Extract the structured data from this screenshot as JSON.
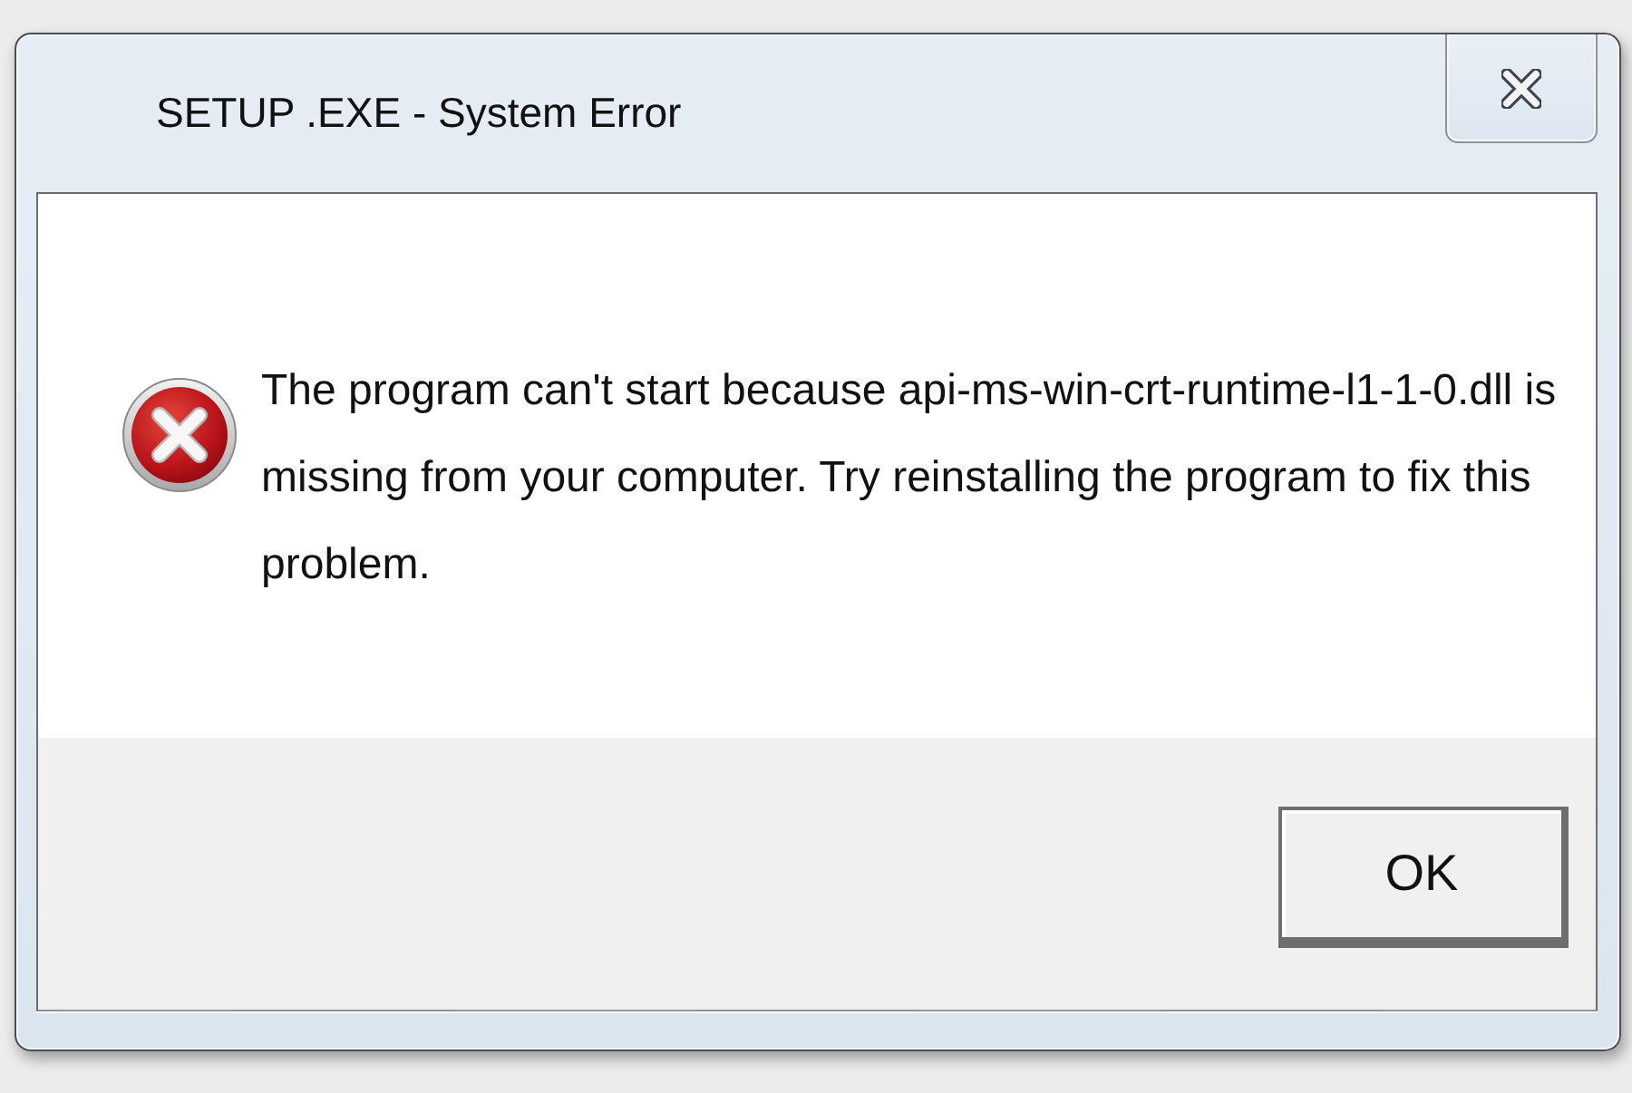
{
  "window": {
    "title": "SETUP .EXE - System Error"
  },
  "message": {
    "kind": "error",
    "text": "The program can't start because api-ms-win-crt-runtime-l1-1-0.dll is missing from your computer. Try reinstalling the program to fix this problem."
  },
  "buttons": [
    {
      "label": "OK"
    }
  ]
}
